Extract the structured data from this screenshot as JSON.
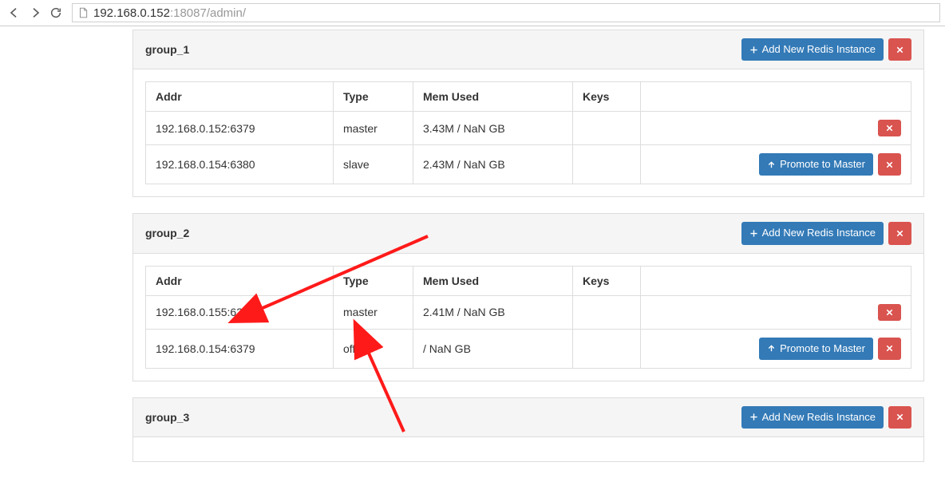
{
  "browser": {
    "url_host": "192.168.0.152",
    "url_rest": ":18087/admin/"
  },
  "buttons": {
    "add_instance": "Add New Redis Instance",
    "promote": "Promote to Master"
  },
  "columns": {
    "addr": "Addr",
    "type": "Type",
    "mem": "Mem Used",
    "keys": "Keys"
  },
  "groups": [
    {
      "name": "group_1",
      "rows": [
        {
          "addr": "192.168.0.152:6379",
          "type": "master",
          "mem": "3.43M / NaN GB",
          "keys": "",
          "canPromote": false
        },
        {
          "addr": "192.168.0.154:6380",
          "type": "slave",
          "mem": "2.43M / NaN GB",
          "keys": "",
          "canPromote": true
        }
      ]
    },
    {
      "name": "group_2",
      "rows": [
        {
          "addr": "192.168.0.155:6380",
          "type": "master",
          "mem": "2.41M / NaN GB",
          "keys": "",
          "canPromote": false
        },
        {
          "addr": "192.168.0.154:6379",
          "type": "offline",
          "mem": " / NaN GB",
          "keys": "",
          "canPromote": true
        }
      ]
    },
    {
      "name": "group_3",
      "rows": []
    }
  ]
}
